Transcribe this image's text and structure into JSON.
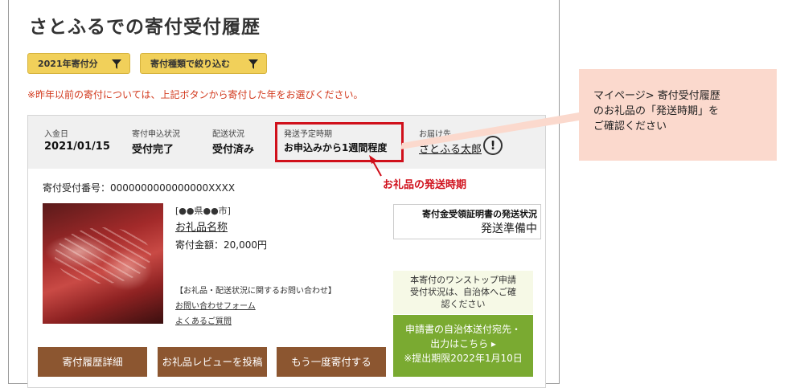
{
  "page_title": "さとふるでの寄付受付履歴",
  "filters": {
    "year_label": "2021年寄付分",
    "type_label": "寄付種類で絞り込む"
  },
  "note": "※昨年以前の寄付については、上記ボタンから寄付した年をお選びください。",
  "card": {
    "header": {
      "payment_date_label": "入金日",
      "payment_date": "2021/01/15",
      "application_status_label": "寄付申込状況",
      "application_status": "受付完了",
      "delivery_status_label": "配送状況",
      "delivery_status": "受付済み",
      "ship_schedule_label": "発送予定時期",
      "ship_schedule": "お申込みから1週間程度",
      "recipient_label": "お届け先",
      "recipient_name": "さとふる太郎",
      "warning_icon": "!"
    },
    "order_number": "寄付受付番号：0000000000000000XXXX",
    "region": "[●●県●●市]",
    "item_name": "お礼品名称",
    "amount": "寄付金額：20,000円",
    "inquiry_heading": "【お礼品・配送状況に関するお問い合わせ】",
    "inquiry_form_link": "お問い合わせフォーム",
    "faq_link": "よくあるご質問",
    "certificate": {
      "title": "寄付金受領証明書の発送状況",
      "status": "発送準備中"
    },
    "onestop": {
      "note_lines": [
        "本寄付のワンストップ申請",
        "受付状況は、自治体へご確",
        "認ください"
      ],
      "button_lines": [
        "申請書の自治体送付宛先・",
        "出力はこちら ▸",
        "※提出期限2022年1月10日"
      ]
    },
    "actions": {
      "history_detail": "寄付履歴詳細",
      "post_review": "お礼品レビューを投稿",
      "donate_again": "もう一度寄付する"
    }
  },
  "annotations": {
    "callout_lines": [
      "マイページ> 寄付受付履歴",
      "のお礼品の「発送時期」を",
      "ご確認ください"
    ],
    "red_label": "お礼品の発送時期"
  },
  "colors": {
    "filter_button": "#f1d05a",
    "note_text": "#d2391d",
    "highlight_border": "#d0101b",
    "action_button": "#8c5630",
    "onestop_button": "#7aaa31",
    "callout_bg": "#fbd9cd"
  }
}
